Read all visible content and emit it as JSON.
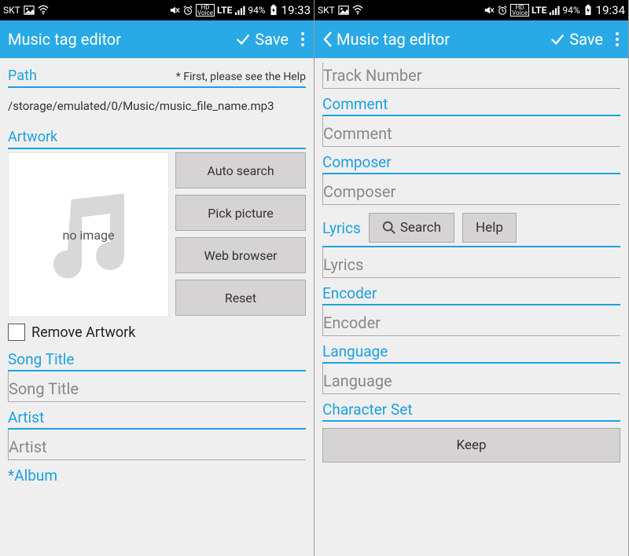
{
  "status": {
    "carrier": "SKT",
    "hd_voice": "HD\nVoice",
    "lte": "LTE",
    "battery": "94%",
    "time_left": "19:33",
    "time_right": "19:34"
  },
  "header": {
    "title": "Music tag editor",
    "save": "Save"
  },
  "left": {
    "path_label": "Path",
    "path_note": "* First, please see the Help",
    "path_value": "/storage/emulated/0/Music/music_file_name.mp3",
    "artwork_label": "Artwork",
    "no_image": "no image",
    "btn_auto": "Auto search",
    "btn_pick": "Pick picture",
    "btn_web": "Web browser",
    "btn_reset": "Reset",
    "remove_artwork": "Remove Artwork",
    "song_title_label": "Song Title",
    "song_title_value": "Song Title",
    "artist_label": "Artist",
    "artist_value": "Artist",
    "album_label": "Album"
  },
  "right": {
    "track_value": "Track Number",
    "comment_label": "Comment",
    "comment_value": "Comment",
    "composer_label": "Composer",
    "composer_value": "Composer",
    "lyrics_label": "Lyrics",
    "btn_search": "Search",
    "btn_help": "Help",
    "lyrics_value": "Lyrics",
    "encoder_label": "Encoder",
    "encoder_value": "Encoder",
    "language_label": "Language",
    "language_value": "Language",
    "charset_label": "Character Set",
    "btn_keep": "Keep"
  }
}
